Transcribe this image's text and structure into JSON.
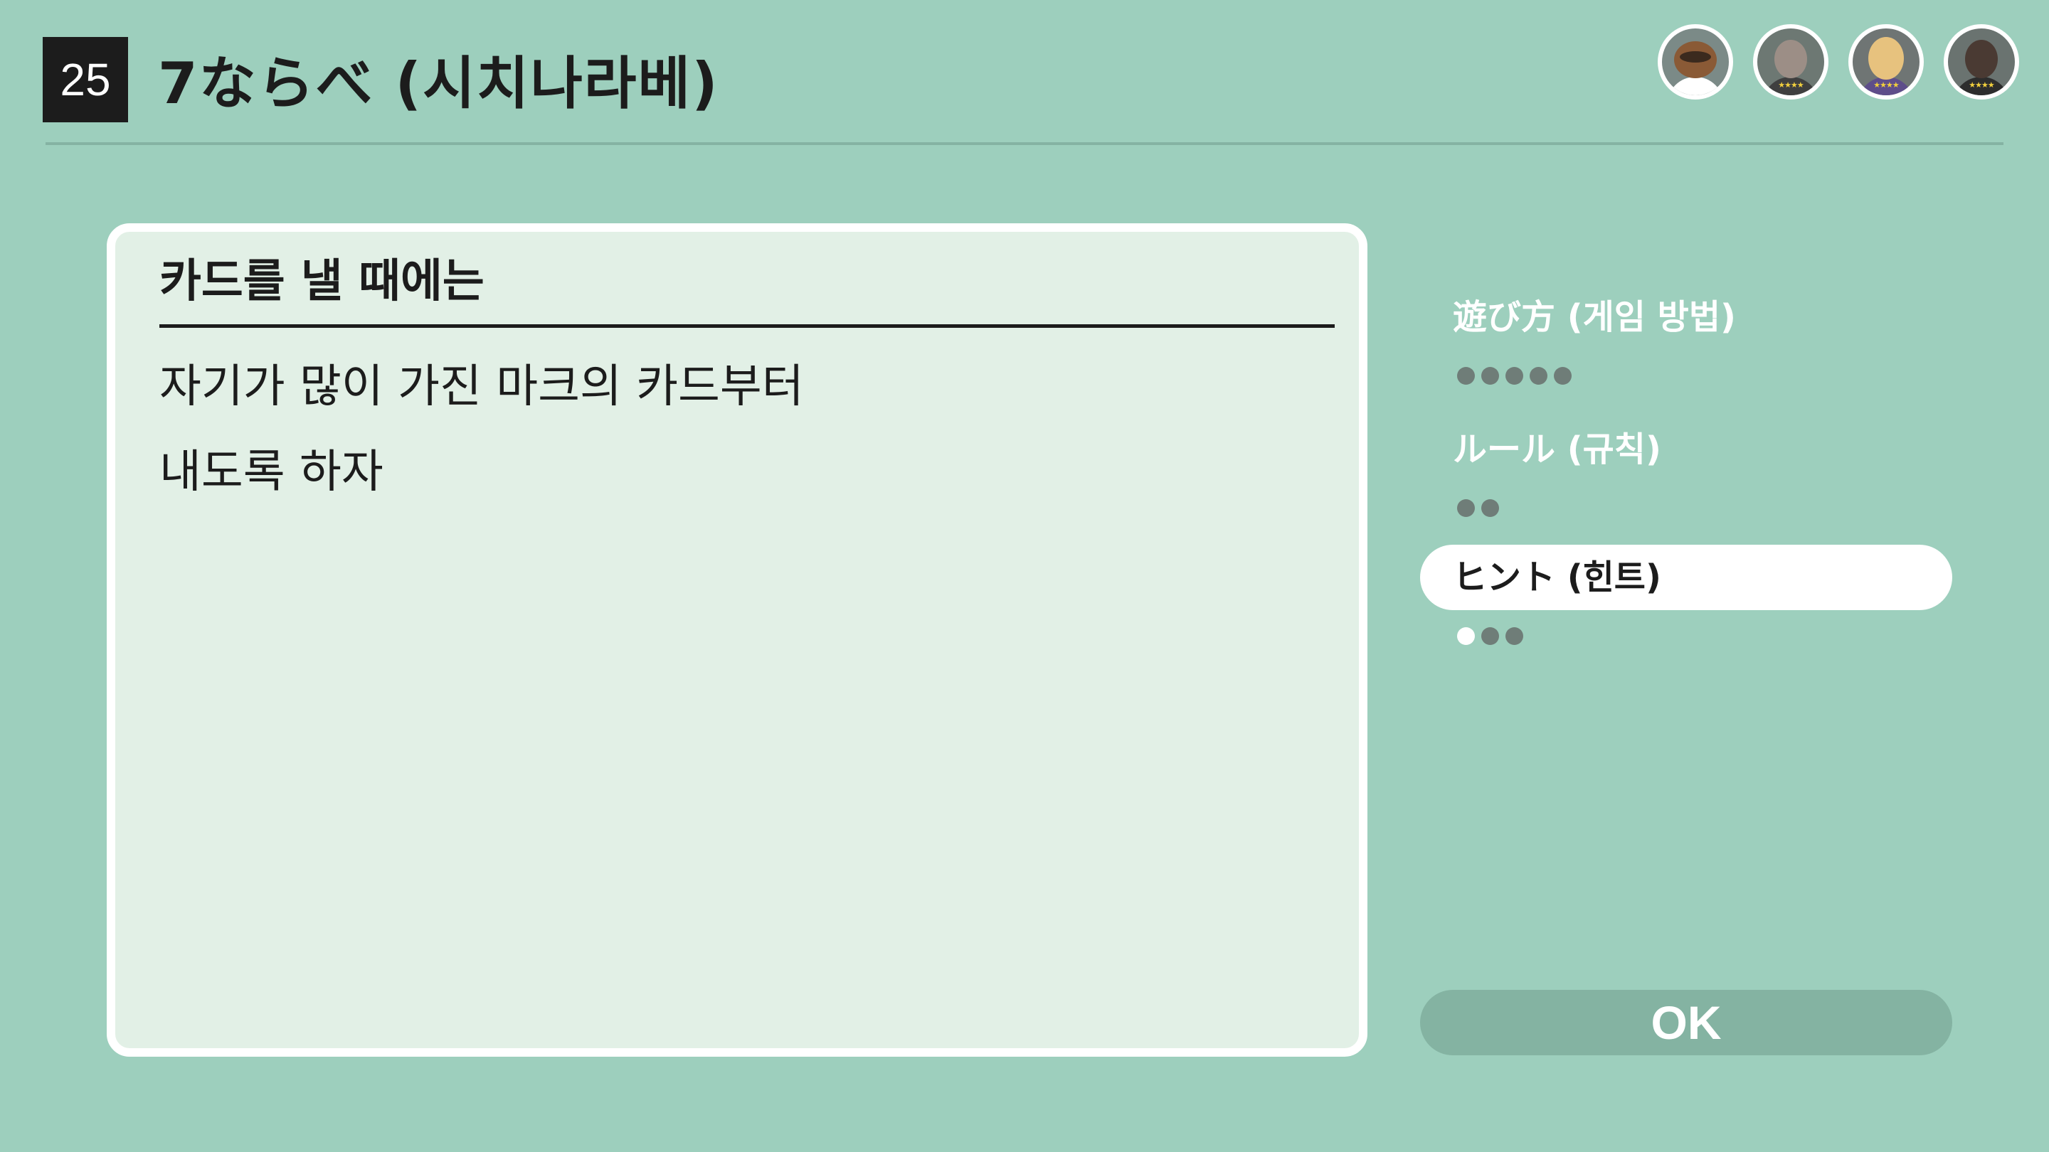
{
  "header": {
    "game_number": "25",
    "title": "7ならべ (시치나라베)"
  },
  "players": [
    {
      "name": "avatar-raccoon",
      "icon": "raccoon-avatar-icon",
      "bg": "#7b8a87",
      "head": "#8a5a36",
      "body": "#ffffff",
      "stars": ""
    },
    {
      "name": "avatar-bearded-man",
      "icon": "bearded-man-avatar-icon",
      "bg": "#6d7873",
      "head": "#9c8e86",
      "body": "#3f3f3f",
      "stars": "★★★★"
    },
    {
      "name": "avatar-blonde-woman",
      "icon": "blonde-woman-avatar-icon",
      "bg": "#6f7574",
      "head": "#e7c27e",
      "body": "#5e4d8a",
      "stars": "★★★★"
    },
    {
      "name": "avatar-dark-man",
      "icon": "dark-man-avatar-icon",
      "bg": "#6a7370",
      "head": "#4a3a33",
      "body": "#2d2d2d",
      "stars": "★★★★"
    }
  ],
  "card": {
    "heading": "카드를 낼 때에는",
    "lines": [
      "자기가 많이 가진 마크의 카드부터",
      "내도록 하자"
    ]
  },
  "menu": {
    "how_to_play": {
      "label": "遊び方 (게임 방법)",
      "pages": 5
    },
    "rules": {
      "label": "ルール (규칙)",
      "pages": 2
    },
    "hints": {
      "label": "ヒント (힌트)",
      "pages": 3,
      "current_page": 1
    }
  },
  "ok_button": "OK",
  "colors": {
    "background": "#9dcfbd",
    "card": "#e2f0e6",
    "text": "#1c1c1c",
    "dot": "#6f7d78",
    "ok": "#84b3a2"
  }
}
